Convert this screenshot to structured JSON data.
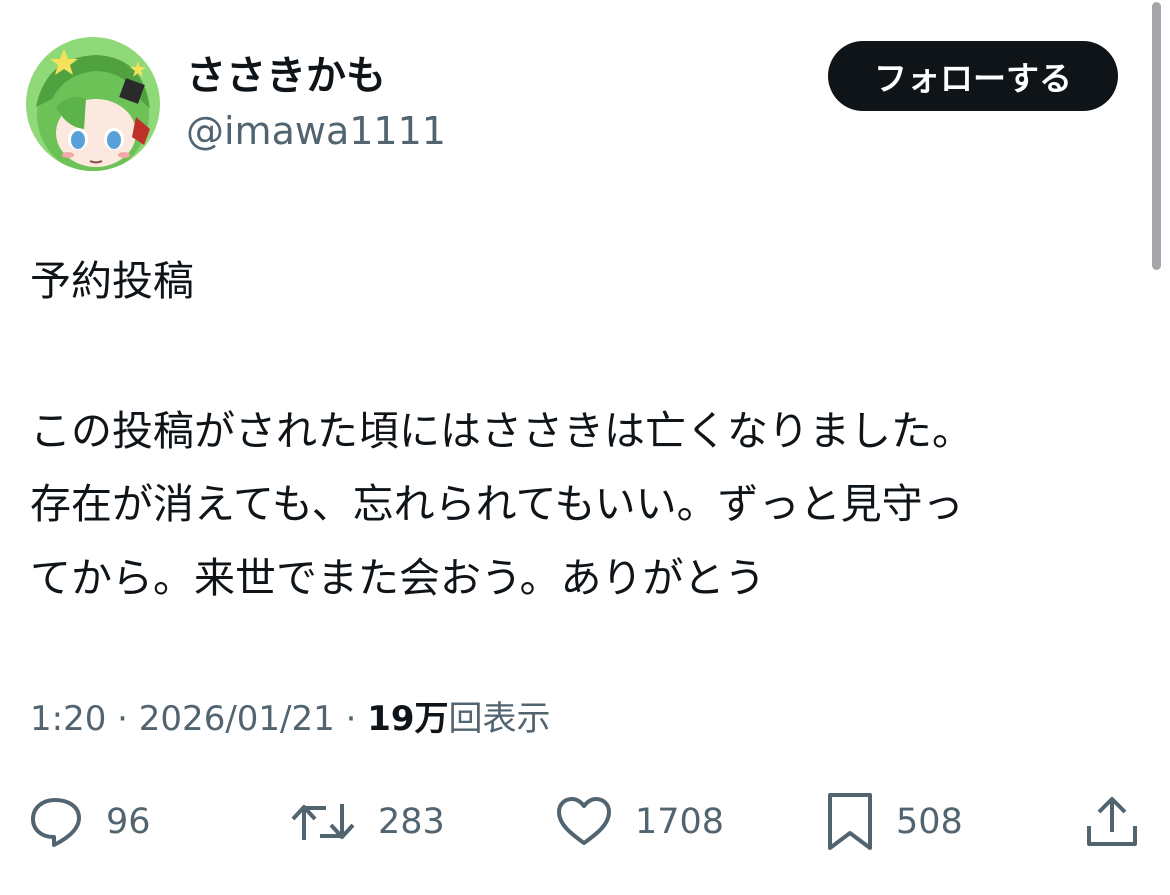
{
  "author": {
    "display_name": "ささきかも",
    "handle": "@imawa1111"
  },
  "follow_button": {
    "label": "フォローする"
  },
  "tweet": {
    "lines": [
      "予約投稿",
      "この投稿がされた頃にはささきは亡くなりました。",
      "存在が消えても、忘れられてもいい。ずっと見守っ",
      "てから。来世でまた会おう。ありがとう"
    ]
  },
  "meta": {
    "time": "1:20",
    "separator": " · ",
    "date": "2026/01/21",
    "views_count": "19万",
    "views_label": "回表示"
  },
  "actions": {
    "replies": "96",
    "retweets": "283",
    "likes": "1708",
    "bookmarks": "508"
  },
  "icons": {
    "reply": "speech-bubble-icon",
    "retweet": "retweet-arrows-icon",
    "like": "heart-icon",
    "bookmark": "bookmark-icon",
    "share": "share-upload-icon"
  },
  "colors": {
    "text": "#0f1419",
    "secondary": "#536471",
    "button_bg": "#0f1419",
    "avatar_hair": "#7fcf68"
  }
}
